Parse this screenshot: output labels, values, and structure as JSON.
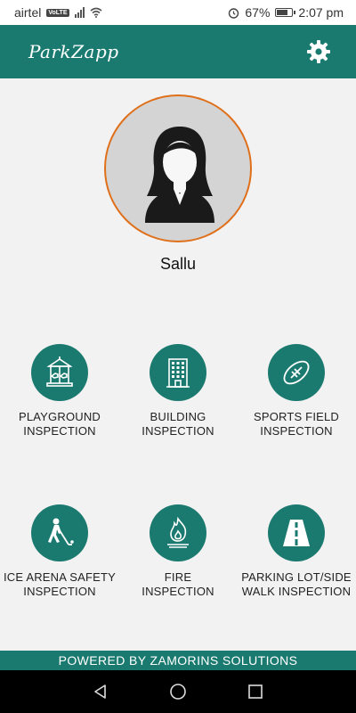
{
  "status_bar": {
    "carrier": "airtel",
    "network_badge": "VoLTE",
    "battery_percent": "67%",
    "battery_level": 0.67,
    "time": "2:07 pm",
    "icons": [
      "signal-icon",
      "wifi-icon",
      "alarm-icon",
      "battery-icon"
    ]
  },
  "app_bar": {
    "logo_text": "ParkZapp",
    "settings_icon": "gear-icon"
  },
  "profile": {
    "name": "Sallu",
    "avatar_icon": "person-avatar-icon"
  },
  "tiles": [
    {
      "line1": "PLAYGROUND",
      "line2": "INSPECTION",
      "icon": "carousel-icon"
    },
    {
      "line1": "BUILDING",
      "line2": "INSPECTION",
      "icon": "building-icon"
    },
    {
      "line1": "SPORTS FIELD",
      "line2": "INSPECTION",
      "icon": "football-icon"
    },
    {
      "line1": "ICE ARENA SAFETY",
      "line2": "INSPECTION",
      "icon": "hockey-player-icon"
    },
    {
      "line1": "FIRE",
      "line2": "INSPECTION",
      "icon": "fire-icon"
    },
    {
      "line1": "PARKING LOT/SIDE",
      "line2": "WALK INSPECTION",
      "icon": "road-icon"
    }
  ],
  "footer": {
    "text": "POWERED BY ZAMORINS SOLUTIONS"
  },
  "nav_bar": {
    "icons": [
      "back-icon",
      "home-icon",
      "recents-icon"
    ]
  },
  "colors": {
    "primary": "#1b7a70",
    "avatar_border": "#e06f1a",
    "background": "#f3f2f2"
  }
}
